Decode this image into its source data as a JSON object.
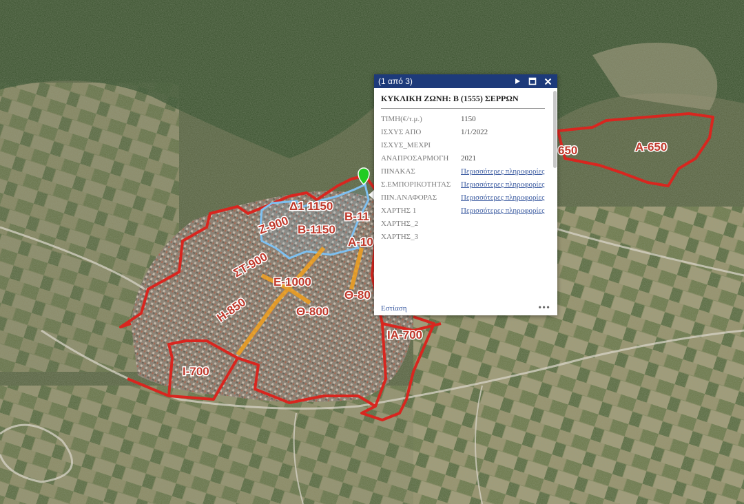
{
  "map": {
    "zones": {
      "a650_left": "650",
      "a650": "Α-650",
      "b1150_top": "Β-11",
      "d1150": "Δ1 1150",
      "z900": "Ζ-900",
      "b1150": "Β-1150",
      "a10": "Α-10",
      "st900": "ΣΤ-900",
      "e1000": "Ε-1000",
      "th800_right": "Θ-80",
      "th800": "Θ-800",
      "h850": "Η-850",
      "ia700": "ΙΑ-700",
      "i700": "Ι-700"
    },
    "colors": {
      "zone_outline": "#d8261f",
      "selected_zone": "#7ec0f0",
      "highlight_street": "#f0a020",
      "marker": "#22cc22"
    }
  },
  "popup": {
    "count": "(1 από 3)",
    "title": "ΚΥΚΛΙΚΗ ΖΩΝΗ: Β (1555) ΣΕΡΡΩΝ",
    "rows": [
      {
        "key": "ΤΙΜΗ(€/τ.μ.)",
        "value": "1150"
      },
      {
        "key": "ΙΣΧΥΣ ΑΠΟ",
        "value": "1/1/2022"
      },
      {
        "key": "ΙΣΧΥΣ_ΜΕΧΡΙ",
        "value": ""
      },
      {
        "key": "ΑΝΑΠΡΟΣΑΡΜΟΓΗ",
        "value": "2021"
      },
      {
        "key": "ΠΙΝΑΚΑΣ",
        "link": "Περισσότερες πληροφορίες"
      },
      {
        "key": "Σ.ΕΜΠΟΡΙΚΟΤΗΤΑΣ",
        "link": "Περισσότερες πληροφορίες"
      },
      {
        "key": "ΠΙΝ.ΑΝΑΦΟΡΑΣ",
        "link": "Περισσότερες πληροφορίες"
      },
      {
        "key": "ΧΑΡΤΗΣ 1",
        "link": "Περισσότερες πληροφορίες"
      },
      {
        "key": "ΧΑΡΤΗΣ_2",
        "value": ""
      },
      {
        "key": "ΧΑΡΤΗΣ_3",
        "value": ""
      }
    ],
    "zoom_label": "Εστίαση",
    "more_label": "•••",
    "icons": {
      "next": "play-icon",
      "maximize": "maximize-icon",
      "close": "close-icon"
    },
    "header_color": "#1d3a7a"
  }
}
